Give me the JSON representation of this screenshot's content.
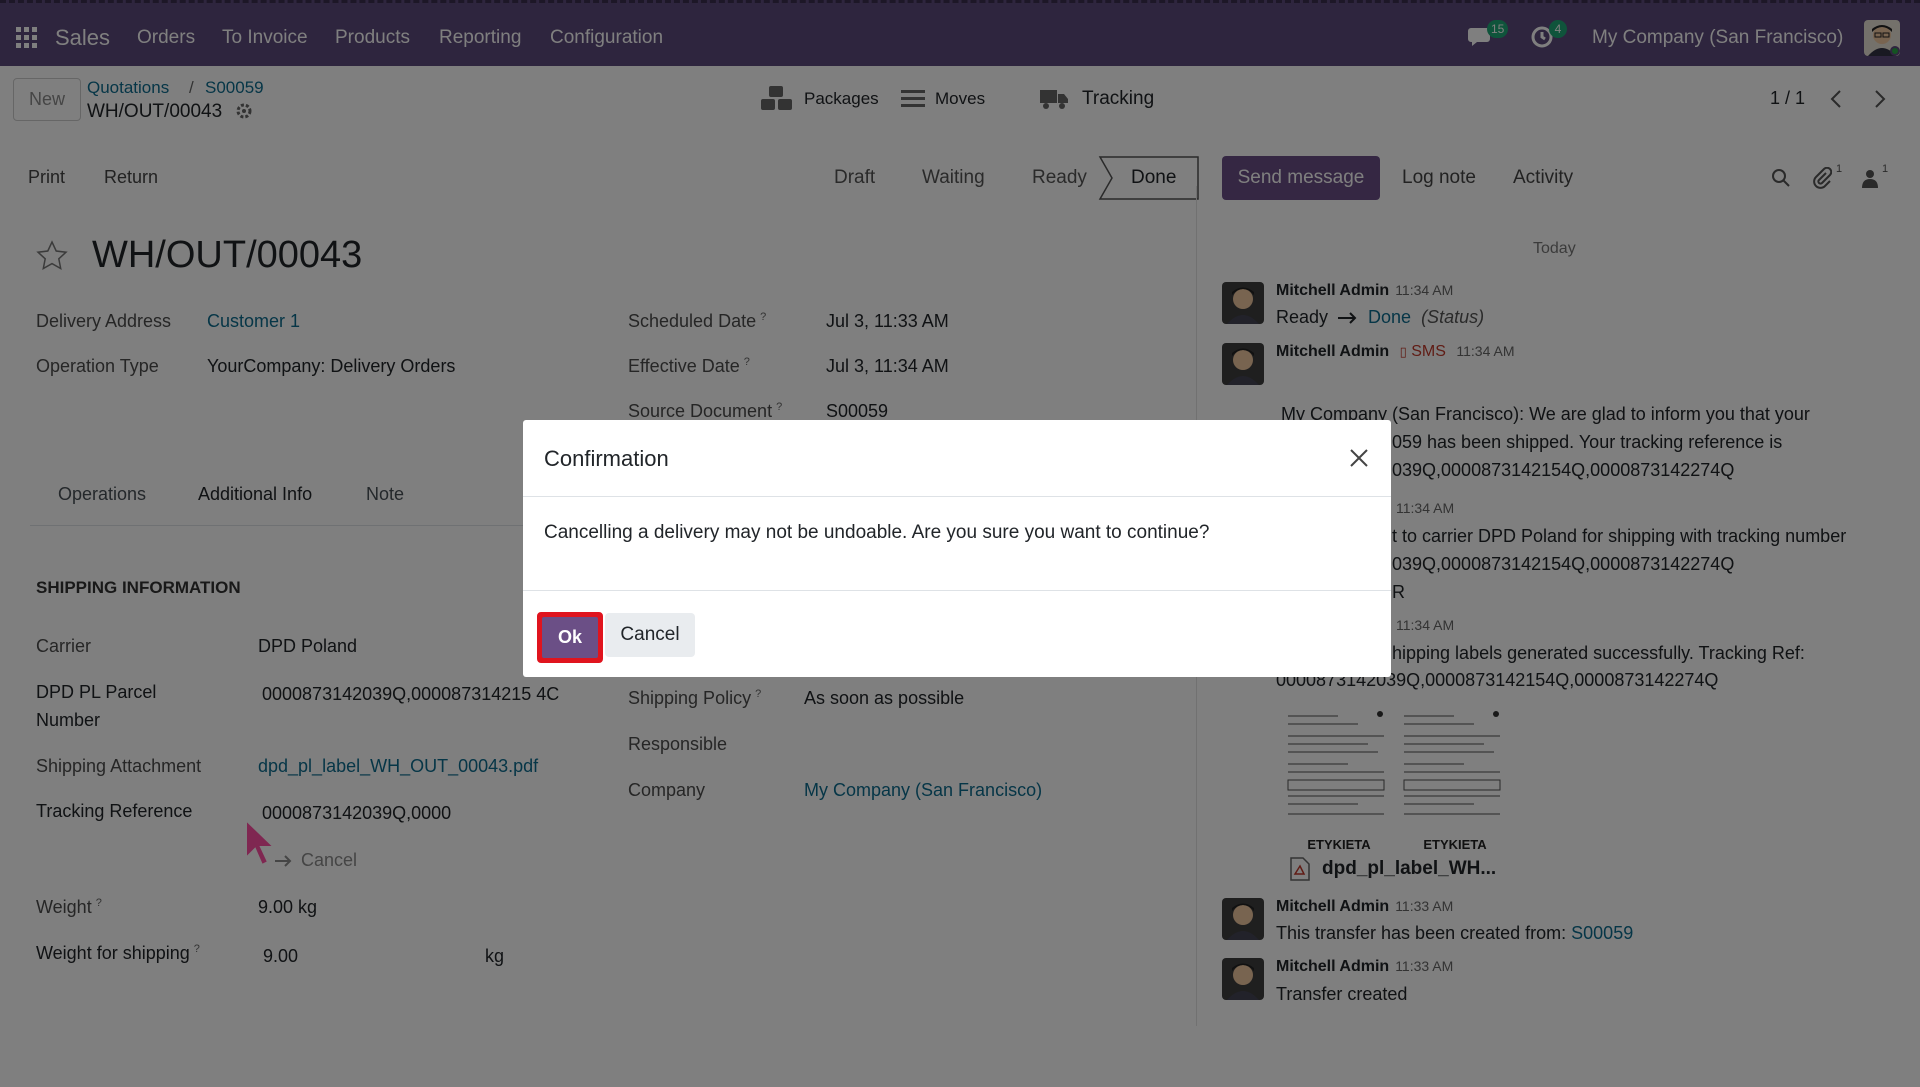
{
  "navbar": {
    "app": "Sales",
    "menu": [
      "Orders",
      "To Invoice",
      "Products",
      "Reporting",
      "Configuration"
    ],
    "messages_count": "15",
    "activities_count": "4",
    "company": "My Company (San Francisco)"
  },
  "control": {
    "new_label": "New",
    "breadcrumb": [
      "Quotations",
      "S00059"
    ],
    "record": "WH/OUT/00043",
    "smart_buttons": {
      "packages": "Packages",
      "moves": "Moves",
      "tracking": "Tracking"
    },
    "pager": "1 / 1",
    "actions": {
      "print": "Print",
      "return": "Return"
    },
    "statuses": [
      "Draft",
      "Waiting",
      "Ready",
      "Done"
    ],
    "active_status": "Done"
  },
  "form": {
    "title": "WH/OUT/00043",
    "delivery_address": {
      "label": "Delivery Address",
      "value": "Customer 1"
    },
    "operation_type": {
      "label": "Operation Type",
      "value": "YourCompany: Delivery Orders"
    },
    "scheduled_date": {
      "label": "Scheduled Date",
      "value": "Jul 3, 11:33 AM"
    },
    "effective_date": {
      "label": "Effective Date",
      "value": "Jul 3, 11:34 AM"
    },
    "source_document": {
      "label": "Source Document",
      "value": "S00059"
    },
    "help_mark": "?",
    "tabs": [
      "Operations",
      "Additional Info",
      "Note"
    ],
    "active_tab": "Additional Info",
    "shipping_section": "SHIPPING INFORMATION",
    "carrier": {
      "label": "Carrier",
      "value": "DPD Poland"
    },
    "parcel_number": {
      "label_1": "DPD PL Parcel",
      "label_2": "Number",
      "value": "0000873142039Q,000087314215 4C"
    },
    "attachment": {
      "label": "Shipping Attachment",
      "value": "dpd_pl_label_WH_OUT_00043.pdf"
    },
    "tracking_ref": {
      "label": "Tracking Reference",
      "value": "0000873142039Q,0000",
      "cancel": "Cancel"
    },
    "weight": {
      "label": "Weight",
      "value": "9.00 kg"
    },
    "weight_shipping": {
      "label": "Weight for shipping",
      "value": "9.00",
      "unit": "kg"
    },
    "shipping_policy": {
      "label": "Shipping Policy",
      "value": "As soon as possible"
    },
    "responsible": {
      "label": "Responsible",
      "value": ""
    },
    "company": {
      "label": "Company",
      "value": "My Company (San Francisco)"
    }
  },
  "chatter": {
    "send_message": "Send message",
    "log_note": "Log note",
    "activity": "Activity",
    "attachments_count": "1",
    "followers_count": "1",
    "date_sep": "Today",
    "m1": {
      "author": "Mitchell Admin",
      "time": "11:34 AM",
      "from": "Ready",
      "to": "Done",
      "field": "(Status)"
    },
    "m2": {
      "author": "Mitchell Admin",
      "tag": "SMS",
      "time": "11:34 AM",
      "l1": "My Company (San Francisco): We are glad to inform you that your",
      "l2": "059 has been shipped. Your tracking reference is",
      "l3": "039Q,0000873142154Q,0000873142274Q"
    },
    "m3": {
      "time": "11:34 AM",
      "l1": "t to carrier DPD Poland for shipping with tracking number",
      "l2": "039Q,0000873142154Q,0000873142274Q",
      "l3": "R"
    },
    "m4": {
      "time": "11:34 AM",
      "l1": "hipping labels generated successfully. Tracking Ref:",
      "l2": "0000873142039Q,0000873142154Q,0000873142274Q"
    },
    "label_text": "ETYKIETA",
    "attachment_name": "dpd_pl_label_WH...",
    "m5": {
      "author": "Mitchell Admin",
      "time": "11:33 AM",
      "text": "This transfer has been created from:",
      "link": "S00059"
    },
    "m6": {
      "author": "Mitchell Admin",
      "time": "11:33 AM",
      "text": "Transfer created"
    }
  },
  "dialog": {
    "title": "Confirmation",
    "body": "Cancelling a delivery may not be undoable. Are you sure you want to continue?",
    "ok": "Ok",
    "cancel": "Cancel"
  }
}
